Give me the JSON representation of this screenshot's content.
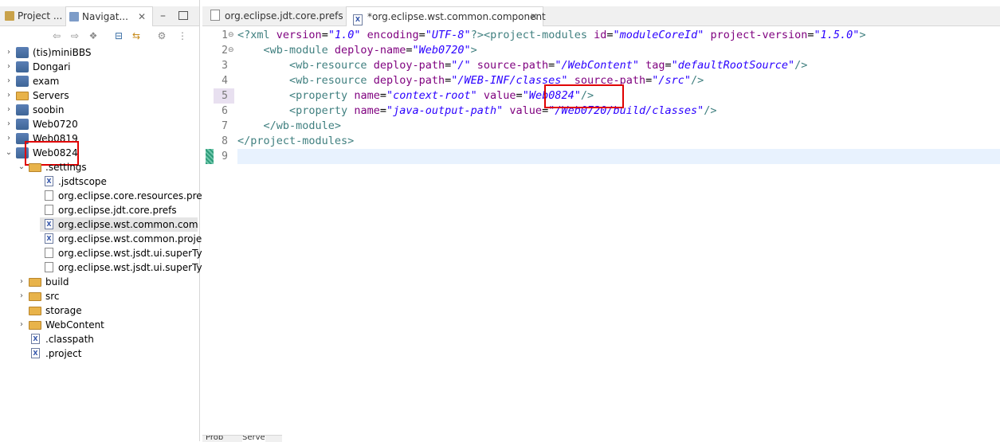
{
  "left_panel": {
    "tabs": [
      {
        "label": "Project ..."
      },
      {
        "label": "Navigat..."
      }
    ],
    "tree": [
      {
        "label": "(tis)miniBBS"
      },
      {
        "label": "Dongari"
      },
      {
        "label": "exam"
      },
      {
        "label": "Servers"
      },
      {
        "label": "soobin"
      },
      {
        "label": "Web0720"
      },
      {
        "label": "Web0819"
      },
      {
        "label": "Web0824"
      },
      {
        "label": ".settings"
      },
      {
        "label": ".jsdtscope"
      },
      {
        "label": "org.eclipse.core.resources.prefs"
      },
      {
        "label": "org.eclipse.jdt.core.prefs"
      },
      {
        "label": "org.eclipse.wst.common.component"
      },
      {
        "label": "org.eclipse.wst.common.project."
      },
      {
        "label": "org.eclipse.wst.jsdt.ui.superType."
      },
      {
        "label": "org.eclipse.wst.jsdt.ui.superType."
      },
      {
        "label": "build"
      },
      {
        "label": "src"
      },
      {
        "label": "storage"
      },
      {
        "label": "WebContent"
      },
      {
        "label": ".classpath"
      },
      {
        "label": ".project"
      }
    ]
  },
  "editor": {
    "tabs": [
      {
        "label": "org.eclipse.jdt.core.prefs"
      },
      {
        "label": "*org.eclipse.wst.common.component"
      }
    ],
    "line_numbers": [
      "1",
      "2",
      "3",
      "4",
      "5",
      "6",
      "7",
      "8",
      "9"
    ],
    "lines": [
      [
        "<?xml ",
        "version",
        "=",
        "\"1.0\"",
        " ",
        "encoding",
        "=",
        "\"UTF-8\"",
        "?><project-modules ",
        "id",
        "=",
        "\"moduleCoreId\"",
        " ",
        "project-version",
        "=",
        "\"1.5.0\"",
        ">"
      ],
      [
        "    <wb-module ",
        "deploy-name",
        "=",
        "\"Web0720\"",
        ">"
      ],
      [
        "        <wb-resource ",
        "deploy-path",
        "=",
        "\"/\"",
        " ",
        "source-path",
        "=",
        "\"/WebContent\"",
        " ",
        "tag",
        "=",
        "\"defaultRootSource\"",
        "/>"
      ],
      [
        "        <wb-resource ",
        "deploy-path",
        "=",
        "\"/WEB-INF/classes\"",
        " ",
        "source-path",
        "=",
        "\"/src\"",
        "/>"
      ],
      [
        "        <property ",
        "name",
        "=",
        "\"context-root\"",
        " ",
        "value",
        "=",
        "\"Web0824\"",
        "/>"
      ],
      [
        "        <property ",
        "name",
        "=",
        "\"java-output-path\"",
        " ",
        "value",
        "=",
        "\"/Web0720/build/classes\"",
        "/>"
      ],
      [
        "    </wb-module>"
      ],
      [
        "</project-modules>"
      ],
      [
        ""
      ]
    ]
  },
  "colors": {
    "tag": "#3f7f7f",
    "attribute": "#7f007f",
    "value": "#2a00ff",
    "highlight_box": "#e00000",
    "current_line": "#e8f2fe"
  },
  "bottom_tabs": [
    "Prob",
    "Serve"
  ]
}
